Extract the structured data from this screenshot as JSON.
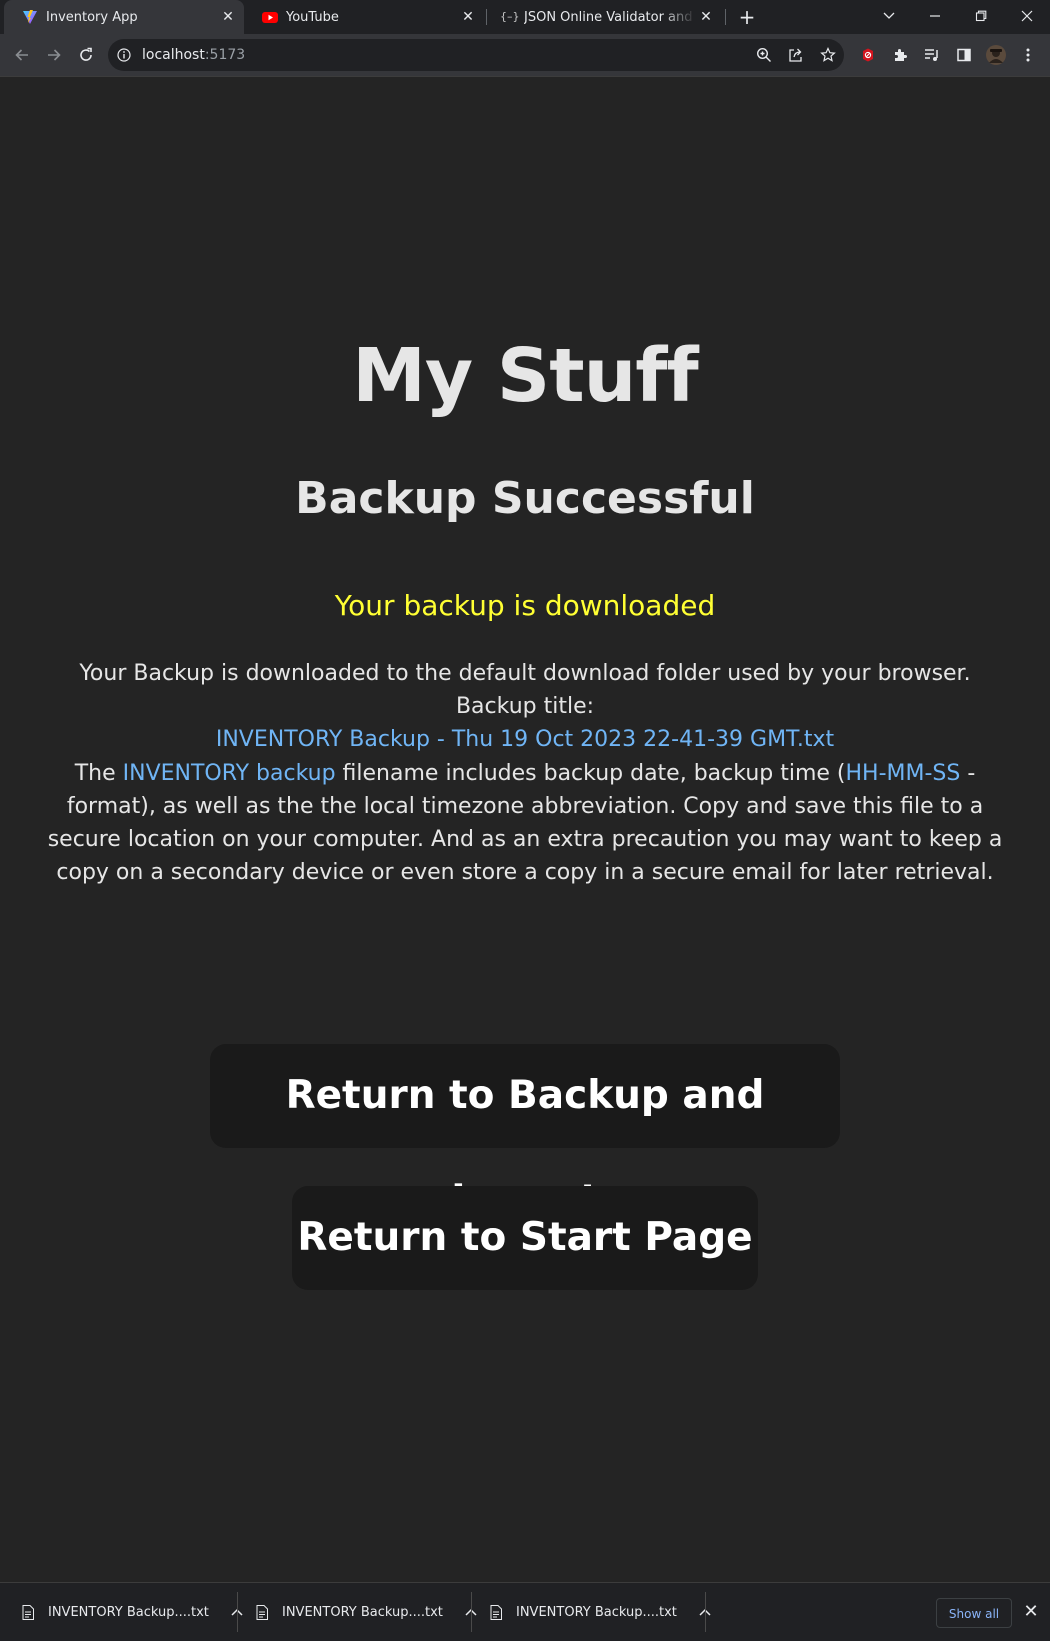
{
  "browser": {
    "tabs": [
      {
        "title": "Inventory App",
        "icon": "vite-logo-icon",
        "active": true
      },
      {
        "title": "YouTube",
        "icon": "youtube-icon",
        "active": false
      },
      {
        "title": "JSON Online Validator and Form",
        "icon": "json-bracket-icon",
        "active": false
      }
    ],
    "address": {
      "host": "localhost",
      "port": ":5173"
    }
  },
  "page": {
    "title": "My Stuff",
    "subtitle": "Backup Successful",
    "status": "Your backup is downloaded",
    "intro": "Your Backup is downloaded to the default download folder used by your browser. Backup title:",
    "filename": "INVENTORY Backup - Thu 19 Oct 2023 22-41-39 GMT.txt",
    "detail_the": "The ",
    "detail_link1": "INVENTORY backup",
    "detail_mid": " filename includes backup date, backup time (",
    "detail_link2": "HH-MM-SS",
    "detail_rest": " - format), as well as the the local timezone abbreviation. Copy and save this file to a secure location on your computer. And as an extra precaution you may want to keep a copy on a secondary device or even store a copy in a secure email for later retrieval.",
    "button_backup": "Return to Backup and Import",
    "button_start": "Return to Start Page"
  },
  "downloads": {
    "items": [
      "INVENTORY Backup....txt",
      "INVENTORY Backup....txt",
      "INVENTORY Backup....txt"
    ],
    "show_all": "Show all"
  },
  "colors": {
    "background": "#242424",
    "status_yellow": "#ffff33",
    "link_blue": "#70b5f5",
    "button_bg": "#1a1a1a"
  }
}
